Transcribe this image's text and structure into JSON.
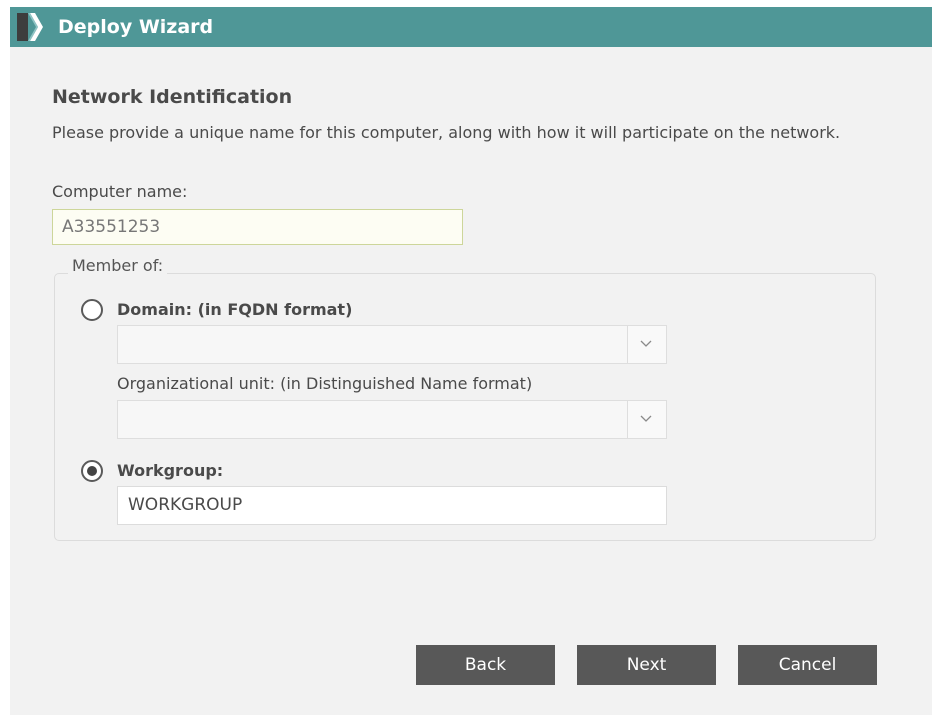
{
  "window": {
    "title": "Deploy Wizard",
    "logo_icon": "chevron-logo-icon"
  },
  "page": {
    "heading": "Network Identification",
    "description": "Please provide a unique name for this computer, along with how it will participate on the network."
  },
  "computer_name": {
    "label": "Computer name:",
    "value": "A33551253"
  },
  "membership": {
    "legend": "Member of:",
    "domain": {
      "label": "Domain: (in FQDN format)",
      "selected": false,
      "value": ""
    },
    "organizational_unit": {
      "label": "Organizational unit: (in Distinguished Name format)",
      "value": ""
    },
    "workgroup": {
      "label": "Workgroup:",
      "selected": true,
      "value": "WORKGROUP"
    }
  },
  "buttons": {
    "back": "Back",
    "next": "Next",
    "cancel": "Cancel"
  },
  "colors": {
    "titlebar": "#4f9797",
    "button": "#585858",
    "background": "#f2f2f2"
  }
}
